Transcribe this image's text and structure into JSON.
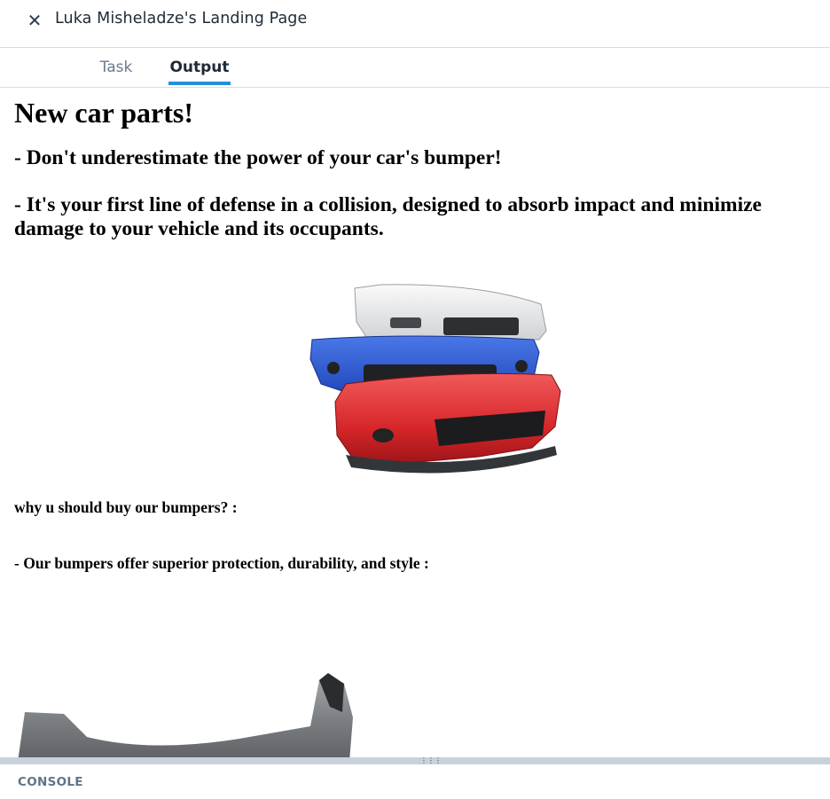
{
  "window": {
    "close_icon": "close-icon",
    "title": "Luka Misheladze's Landing Page"
  },
  "tabs": [
    {
      "label": "Task",
      "active": false
    },
    {
      "label": "Output",
      "active": true
    }
  ],
  "colors": {
    "accent": "#2590da",
    "tab_inactive": "#6a7b8e",
    "text_dark": "#1f2a37",
    "splitter": "#c7d2dc",
    "console_label": "#5f7388"
  },
  "output": {
    "heading": "New car parts!",
    "subheading_1": "- Don't underestimate the power of your car's bumper!",
    "subheading_2": "- It's your first line of defense in a collision, designed to absorb impact and minimize damage to your vehicle and its occupants.",
    "paragraph_1": "why u should buy our bumpers? :",
    "paragraph_2": "- Our bumpers offer superior protection, durability, and style :",
    "images": [
      "stacked-bumpers-image",
      "gray-bumper-image"
    ]
  },
  "console": {
    "label": "CONSOLE"
  }
}
